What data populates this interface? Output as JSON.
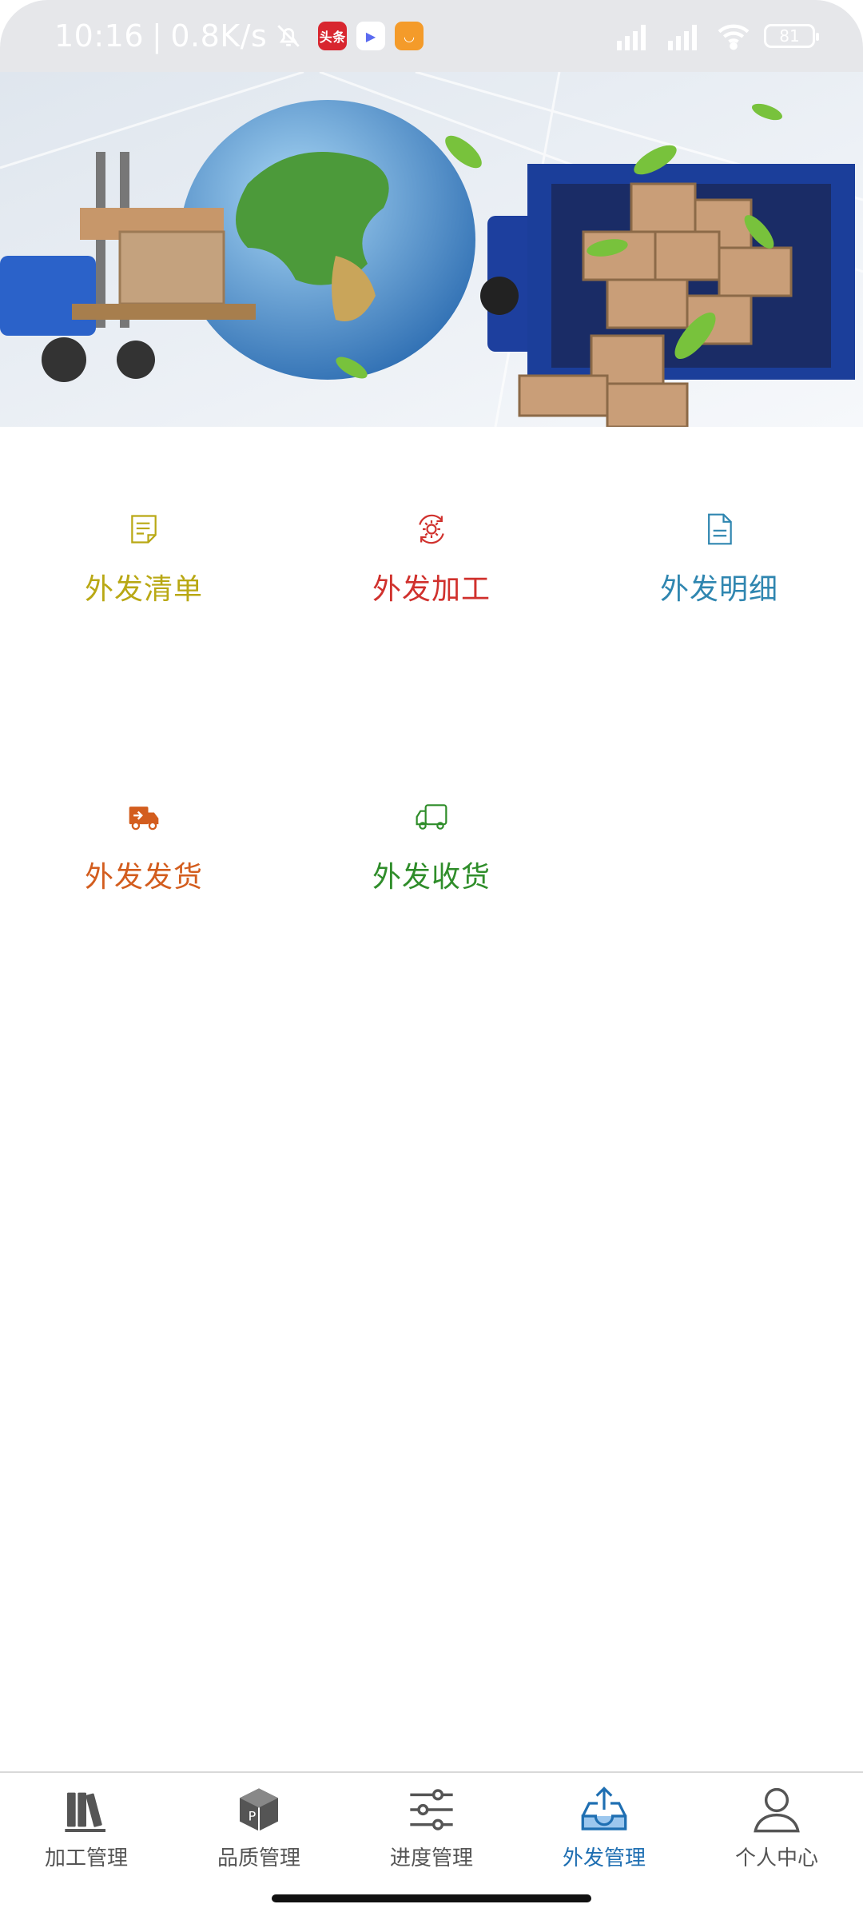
{
  "status_bar": {
    "time": "10:16",
    "net_speed": "0.8K/s",
    "battery": "81",
    "app_icons": [
      {
        "name": "toutiao",
        "label": "头条",
        "color": "#d8262f"
      },
      {
        "name": "video-play",
        "label": "▶",
        "color": "#5b6bf0"
      },
      {
        "name": "smile-app",
        "label": "◡",
        "color": "#f49b2a"
      }
    ]
  },
  "menu": [
    {
      "label": "外发清单",
      "color": "#b9a814",
      "icon": "note-icon"
    },
    {
      "label": "外发加工",
      "color": "#d0312d",
      "icon": "gear-cycle-icon"
    },
    {
      "label": "外发明细",
      "color": "#2f86b0",
      "icon": "document-icon"
    },
    {
      "label": "外发发货",
      "color": "#d35d1e",
      "icon": "delivery-truck-icon"
    },
    {
      "label": "外发收货",
      "color": "#2f8d2a",
      "icon": "truck-outline-icon"
    }
  ],
  "bottom_nav": [
    {
      "label": "加工管理",
      "icon": "books-icon",
      "active": false
    },
    {
      "label": "品质管理",
      "icon": "box-icon",
      "active": false
    },
    {
      "label": "进度管理",
      "icon": "sliders-icon",
      "active": false
    },
    {
      "label": "外发管理",
      "icon": "inbox-upload-icon",
      "active": true
    },
    {
      "label": "个人中心",
      "icon": "person-icon",
      "active": false
    }
  ]
}
